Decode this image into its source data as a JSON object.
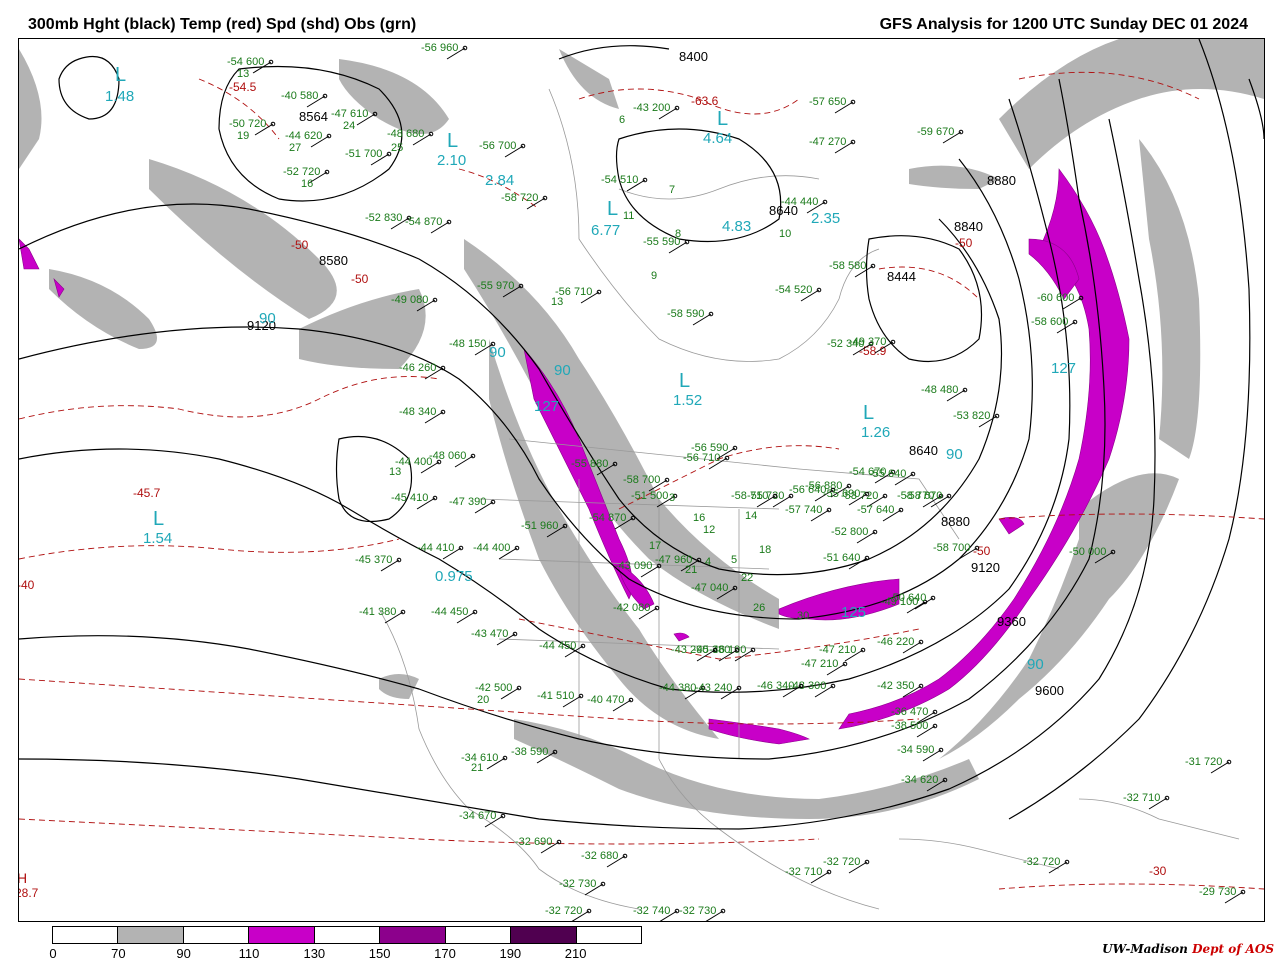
{
  "header": {
    "title_left": "300mb Hght (black) Temp (red) Spd (shd) Obs (grn)",
    "title_right": "GFS Analysis for 1200 UTC Sunday  DEC 01 2024"
  },
  "colors": {
    "height_contour": "#000000",
    "temp_contour": "#b01010",
    "obs": "#1a7a1a",
    "speed_label": "#20a8b8",
    "shade_70": "#b3b3b3",
    "shade_110": "#c800c8",
    "shade_150": "#8c008c",
    "shade_190": "#500050",
    "borders": "#999999"
  },
  "legend": {
    "ticks": [
      "0",
      "70",
      "90",
      "110",
      "130",
      "150",
      "170",
      "190",
      "210"
    ],
    "segment_colors": [
      "#ffffff",
      "#b3b3b3",
      "#ffffff",
      "#c800c8",
      "#ffffff",
      "#8c008c",
      "#ffffff",
      "#500050",
      "#ffffff"
    ]
  },
  "credit": {
    "main": "UW-Madison",
    "dept": "Dept of AOS"
  },
  "height_labels": [
    "8400",
    "8564",
    "8580",
    "8640",
    "8840",
    "8444",
    "8880",
    "8880",
    "9120",
    "9120",
    "9120",
    "9360",
    "9600",
    "8640"
  ],
  "temp_labels": [
    "-54.5",
    "-63.6",
    "-50",
    "-50",
    "-50",
    "-58.9",
    "-45.7",
    "-50",
    "-30",
    "-40",
    "28.7"
  ],
  "speed_labels": [
    "90",
    "90",
    "90",
    "90",
    "90",
    "127",
    "125",
    "127",
    "0.975",
    "1.48",
    "2.10",
    "2.84",
    "6.77",
    "4.64",
    "1.52",
    "1.26",
    "2.35",
    "4.83",
    "1.54"
  ],
  "lows": [
    "L",
    "L",
    "L",
    "L",
    "L",
    "L",
    "L"
  ],
  "highs": [
    "H"
  ],
  "obs": [
    "-54 600",
    "13",
    "-50 720",
    "19",
    "-40 580",
    "-44 620",
    "27",
    "-47 610",
    "24",
    "-48 680",
    "25",
    "-51 700",
    "-52 720",
    "16",
    "-52 830",
    "-54 870",
    "-56 960",
    "-56 700",
    "-58 720",
    "-55 970",
    "-56 710",
    "13",
    "-49 080",
    "-48 150",
    "-46 260",
    "-48 340",
    "-44 400",
    "13",
    "-45 410",
    "-47 390",
    "-44 410",
    "-44 400",
    "-45 370",
    "-41 380",
    "-44 450",
    "-43 470",
    "-44 450",
    "-42 500",
    "20",
    "-41 510",
    "-40 470",
    "-38 590",
    "-34 610",
    "21",
    "-34 670",
    "-32 690",
    "-32 680",
    "-32 730",
    "-32 720",
    "-32 740",
    "-32 730",
    "-32 710",
    "-32 720",
    "-32 720",
    "-29 730",
    "-32 710",
    "-31 720",
    "-34 590",
    "-34 620",
    "-36 470",
    "-38 500",
    "-42 350",
    "-46 220",
    "-47 210",
    "-47 210",
    "-48 300",
    "-46 340",
    "-46 190",
    "-45 380",
    "-43 290",
    "-44 380",
    "-43 240",
    "-42 080",
    "-43 090",
    "-47 960",
    "-47 040",
    "-49 100",
    "-50 640",
    "-51 640",
    "-52 800",
    "-53 720",
    "-54 670",
    "-55 640",
    "-56 880",
    "-56 640",
    "-55 730",
    "-55 690",
    "-57 640",
    "-58 770",
    "-58 670",
    "-58 700",
    "-58 710",
    "-57 740",
    "-56 710",
    "-56 590",
    "-58 590",
    "-54 520",
    "-58 580",
    "-52 340",
    "-49 370",
    "-48 480",
    "-53 820",
    "-58 600",
    "-60 600",
    "-59 670",
    "-57 650",
    "-54 510",
    "-55 590",
    "-44 440",
    "-43 200",
    "-47 270",
    "-50 000",
    "-48 060",
    "-51 960",
    "-55 880",
    "-54 870",
    "-58 700",
    "-51 500",
    "3",
    "4",
    "5",
    "6",
    "7",
    "8",
    "9",
    "10",
    "11",
    "12",
    "14",
    "16",
    "17",
    "18",
    "21",
    "22",
    "26",
    "30"
  ]
}
